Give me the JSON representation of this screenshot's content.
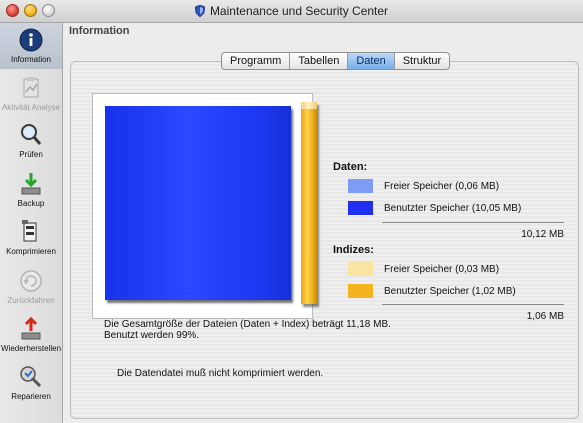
{
  "window": {
    "title": "Maintenance und Security Center"
  },
  "sidebar": {
    "items": [
      {
        "label": "Information",
        "icon": "information-icon",
        "active": true
      },
      {
        "label": "Aktivität Analyse",
        "icon": "activity-analysis-icon",
        "enabled": false
      },
      {
        "label": "Prüfen",
        "icon": "magnifier-icon",
        "enabled": true
      },
      {
        "label": "Backup",
        "icon": "backup-icon",
        "enabled": true
      },
      {
        "label": "Komprimieren",
        "icon": "compress-icon",
        "enabled": true
      },
      {
        "label": "Zurückfahren",
        "icon": "rollback-icon",
        "enabled": false
      },
      {
        "label": "Wiederherstellen",
        "icon": "restore-icon",
        "enabled": true
      },
      {
        "label": "Reparieren",
        "icon": "repair-icon",
        "enabled": true
      }
    ]
  },
  "main": {
    "heading": "Information",
    "tabs": [
      {
        "label": "Programm",
        "active": false
      },
      {
        "label": "Tabellen",
        "active": false
      },
      {
        "label": "Daten",
        "active": true
      },
      {
        "label": "Struktur",
        "active": false
      }
    ]
  },
  "legend": {
    "daten_heading": "Daten:",
    "daten_free": "Freier Speicher (0,06 MB)",
    "daten_used": "Benutzter Speicher (10,05 MB)",
    "daten_total": "10,12 MB",
    "indizes_heading": "Indizes:",
    "indizes_free": "Freier Speicher (0,03 MB)",
    "indizes_used": "Benutzter Speicher (1,02 MB)",
    "indizes_total": "1,06 MB",
    "colors": {
      "daten_free": "#7f9cf5",
      "daten_used": "#1f2ff0",
      "indizes_free": "#fbe3a2",
      "indizes_used": "#f5b320"
    }
  },
  "summary": {
    "line1": "Die Gesamtgröße der Dateien (Daten + Index) beträgt 11,18 MB.",
    "line2": "Benutzt werden 99%."
  },
  "message": "Die Datendatei muß nicht komprimiert werden."
}
